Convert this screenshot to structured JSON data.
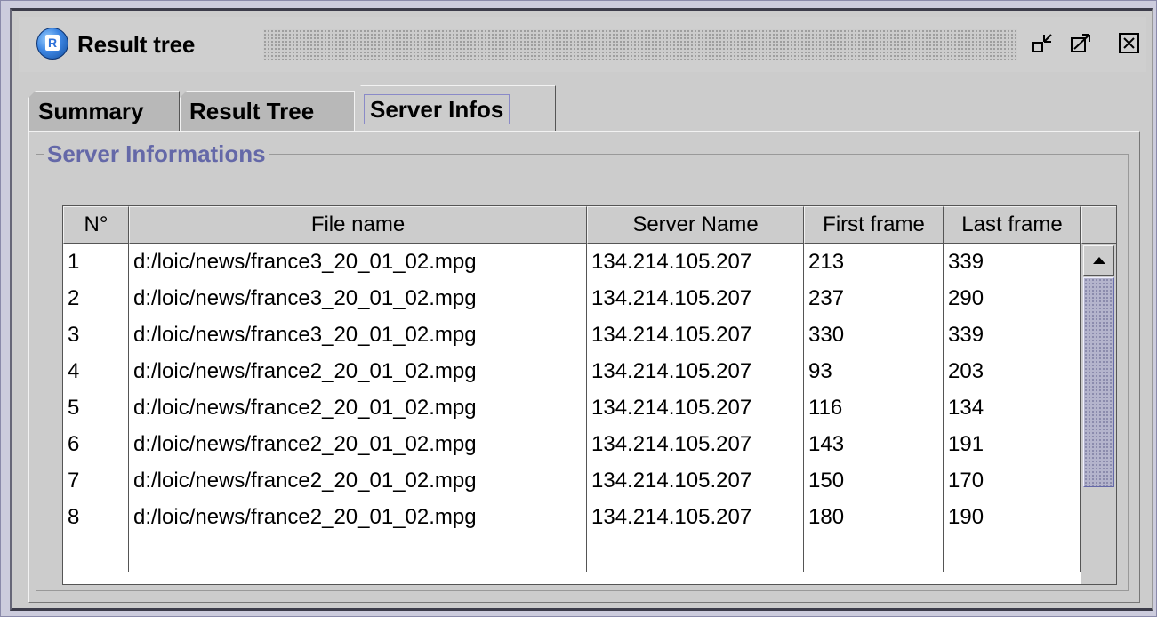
{
  "window": {
    "title": "Result tree",
    "icon_letter": "R",
    "buttons": [
      "restore-down-icon",
      "maximize-icon",
      "close-icon"
    ]
  },
  "tabs": [
    {
      "label": "Summary",
      "selected": false
    },
    {
      "label": "Result Tree",
      "selected": false
    },
    {
      "label": "Server Infos",
      "selected": true
    }
  ],
  "group": {
    "title": "Server Informations"
  },
  "table": {
    "columns": [
      "N°",
      "File name",
      "Server Name",
      "First frame",
      "Last frame"
    ],
    "rows": [
      [
        "1",
        "d:/loic/news/france3_20_01_02.mpg",
        "134.214.105.207",
        "213",
        "339"
      ],
      [
        "2",
        "d:/loic/news/france3_20_01_02.mpg",
        "134.214.105.207",
        "237",
        "290"
      ],
      [
        "3",
        "d:/loic/news/france3_20_01_02.mpg",
        "134.214.105.207",
        "330",
        "339"
      ],
      [
        "4",
        "d:/loic/news/france2_20_01_02.mpg",
        "134.214.105.207",
        "93",
        "203"
      ],
      [
        "5",
        "d:/loic/news/france2_20_01_02.mpg",
        "134.214.105.207",
        "116",
        "134"
      ],
      [
        "6",
        "d:/loic/news/france2_20_01_02.mpg",
        "134.214.105.207",
        "143",
        "191"
      ],
      [
        "7",
        "d:/loic/news/france2_20_01_02.mpg",
        "134.214.105.207",
        "150",
        "170"
      ],
      [
        "8",
        "d:/loic/news/france2_20_01_02.mpg",
        "134.214.105.207",
        "180",
        "190"
      ]
    ]
  },
  "colors": {
    "accent_text": "#6468a8",
    "window_bg": "#cccccc",
    "frame_border": "#3c3c4a"
  }
}
